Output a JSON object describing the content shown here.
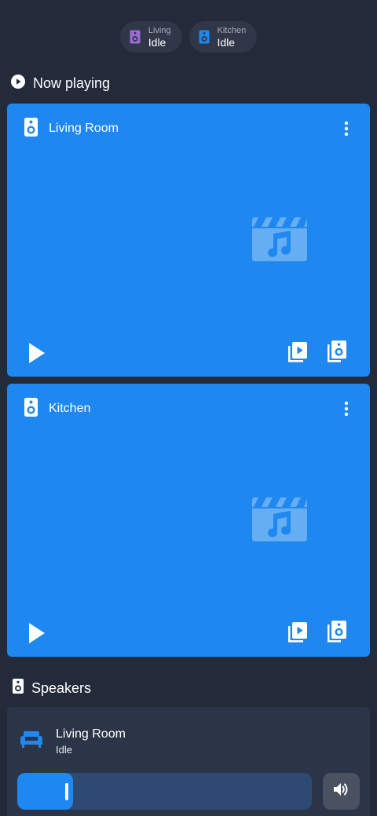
{
  "chips": [
    {
      "name": "Living",
      "state": "Idle",
      "icon": "speaker-icon",
      "color": "#9c6bd8"
    },
    {
      "name": "Kitchen",
      "state": "Idle",
      "icon": "speaker-icon",
      "color": "#1e88f0"
    }
  ],
  "now_playing": {
    "title": "Now playing",
    "icon": "play-circle-icon"
  },
  "players": [
    {
      "name": "Living Room",
      "icon": "speaker-icon",
      "art_icon": "movie-music-icon"
    },
    {
      "name": "Kitchen",
      "icon": "speaker-icon",
      "art_icon": "movie-music-icon"
    }
  ],
  "speakers": {
    "title": "Speakers",
    "icon": "speaker-icon",
    "items": [
      {
        "name": "Living Room",
        "state": "Idle",
        "icon": "sofa-icon",
        "volume": 0.19
      }
    ]
  },
  "colors": {
    "background": "#232b3a",
    "card_blue": "#1e88f0",
    "chip_bg": "#2f3748",
    "speaker_card": "#2c3548",
    "volume_track": "#2e4a73"
  }
}
